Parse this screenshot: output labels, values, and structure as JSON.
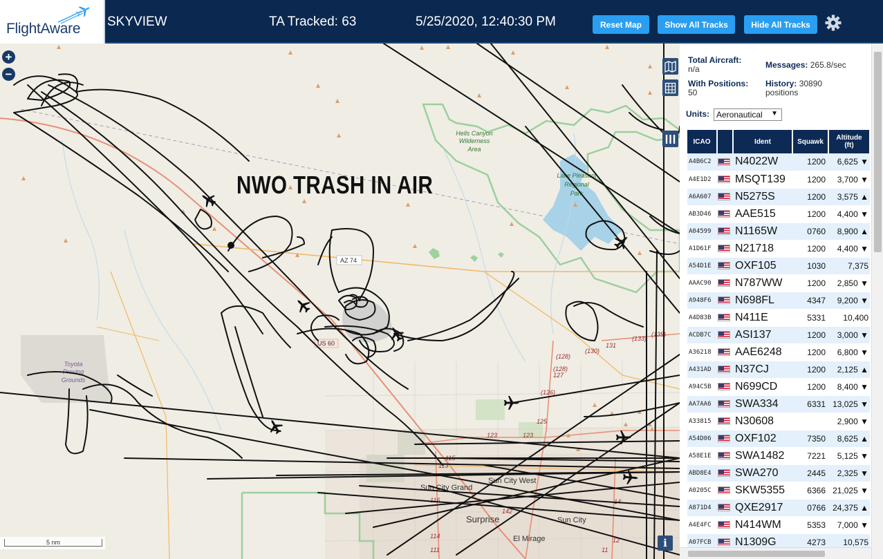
{
  "header": {
    "logo_text": "FlightAware",
    "app_title": "SKYVIEW",
    "tracked": "TA Tracked: 63",
    "datetime": "5/25/2020, 12:40:30 PM",
    "reset_label": "Reset Map",
    "show_label": "Show All Tracks",
    "hide_label": "Hide All Tracks"
  },
  "map": {
    "overlay_text": "NWO TRASH IN AIR",
    "zoom_in": "+",
    "zoom_out": "−",
    "scale": "5 nm",
    "info": "i",
    "labels": {
      "hells_canyon": [
        "Hells Canyon",
        "Wilderness",
        "Area"
      ],
      "lake_pleasant": [
        "Lake Pleasant",
        "Regional",
        "Park"
      ],
      "toyota": [
        "Toyota",
        "Proving",
        "Grounds"
      ],
      "az74": "AZ 74",
      "us60": "US 60",
      "sun_city_west": "Sun City West",
      "sun_city_grand": "Sun City Grand",
      "surprise": "Surprise",
      "sun_city": "Sun City",
      "el_mirage": "El Mirage",
      "r128a": "(128)",
      "r128b": "(128)",
      "r127": "127",
      "r126": "(126)",
      "r125": "125",
      "r123a": "123",
      "r123b": "123",
      "r130": "(130)",
      "r131": "131",
      "r133": "(133)",
      "r135": "(135)",
      "r116": "116",
      "r115": "115",
      "r114": "114",
      "r113": "113",
      "r111": "111",
      "r142": "142",
      "r14": "14",
      "r12": "12",
      "r11": "11"
    }
  },
  "panel": {
    "total_aircraft_label": "Total Aircraft:",
    "total_aircraft_value": "n/a",
    "with_positions_label": "With Positions:",
    "with_positions_value": "50",
    "messages_label": "Messages:",
    "messages_value": "265.8/sec",
    "history_label": "History:",
    "history_value": "30890",
    "history_unit": "positions",
    "units_label": "Units:",
    "units_value": "Aeronautical",
    "columns": {
      "icao": "ICAO",
      "ident": "Ident",
      "squawk": "Squawk",
      "altitude": "Altitude",
      "altitude_unit": "(ft)"
    },
    "rows": [
      {
        "icao": "A4B6C2",
        "ident": "N4022W",
        "squawk": "1200",
        "alt": "6,625 ▼"
      },
      {
        "icao": "A4E1D2",
        "ident": "MSQT139",
        "squawk": "1200",
        "alt": "3,700 ▼"
      },
      {
        "icao": "A6A607",
        "ident": "N5275S",
        "squawk": "1200",
        "alt": "3,575 ▲"
      },
      {
        "icao": "AB3D46",
        "ident": "AAE515",
        "squawk": "1200",
        "alt": "4,400 ▼"
      },
      {
        "icao": "A04599",
        "ident": "N1165W",
        "squawk": "0760",
        "alt": "8,900 ▲"
      },
      {
        "icao": "A1D61F",
        "ident": "N21718",
        "squawk": "1200",
        "alt": "4,400 ▼"
      },
      {
        "icao": "A54D1E",
        "ident": "OXF105",
        "squawk": "1030",
        "alt": "7,375"
      },
      {
        "icao": "AAAC90",
        "ident": "N787WW",
        "squawk": "1200",
        "alt": "2,850 ▼"
      },
      {
        "icao": "A948F6",
        "ident": "N698FL",
        "squawk": "4347",
        "alt": "9,200 ▼"
      },
      {
        "icao": "A4D83B",
        "ident": "N411E",
        "squawk": "5331",
        "alt": "10,400"
      },
      {
        "icao": "ACDB7C",
        "ident": "ASI137",
        "squawk": "1200",
        "alt": "3,000 ▼"
      },
      {
        "icao": "A36218",
        "ident": "AAE6248",
        "squawk": "1200",
        "alt": "6,800 ▼"
      },
      {
        "icao": "A431AD",
        "ident": "N37CJ",
        "squawk": "1200",
        "alt": "2,125 ▲"
      },
      {
        "icao": "A94C5B",
        "ident": "N699CD",
        "squawk": "1200",
        "alt": "8,400 ▼"
      },
      {
        "icao": "AA7AA6",
        "ident": "SWA334",
        "squawk": "6331",
        "alt": "13,025 ▼"
      },
      {
        "icao": "A33815",
        "ident": "N30608",
        "squawk": "",
        "alt": "2,900 ▼"
      },
      {
        "icao": "A54D06",
        "ident": "OXF102",
        "squawk": "7350",
        "alt": "8,625 ▲"
      },
      {
        "icao": "A58E1E",
        "ident": "SWA1482",
        "squawk": "7221",
        "alt": "5,125 ▼"
      },
      {
        "icao": "ABD8E4",
        "ident": "SWA270",
        "squawk": "2445",
        "alt": "2,325 ▼"
      },
      {
        "icao": "A0205C",
        "ident": "SKW5355",
        "squawk": "6366",
        "alt": "21,025 ▼"
      },
      {
        "icao": "A871D4",
        "ident": "QXE2917",
        "squawk": "0766",
        "alt": "24,375 ▲"
      },
      {
        "icao": "A4E4FC",
        "ident": "N414WM",
        "squawk": "5353",
        "alt": "7,000 ▼"
      },
      {
        "icao": "A07FCB",
        "ident": "N1309G",
        "squawk": "4273",
        "alt": "10,575"
      }
    ]
  },
  "colors": {
    "header_bg": "#0a2850",
    "button_blue": "#2a9ef0",
    "table_header": "#0d2a55",
    "row_alt": "#e4f0fb",
    "map_bg": "#f0ede5",
    "track": "#111111",
    "park_border": "#9ccf9c",
    "water": "#a8d2e8"
  },
  "icons": {
    "logo": "airplane-logo-icon",
    "settings": "gear-icon",
    "map_toggle": "map-icon",
    "grid_toggle": "grid-icon",
    "columns_toggle": "columns-icon",
    "aircraft": "airplane-icon",
    "flag": "us-flag-icon",
    "info": "info-icon"
  }
}
